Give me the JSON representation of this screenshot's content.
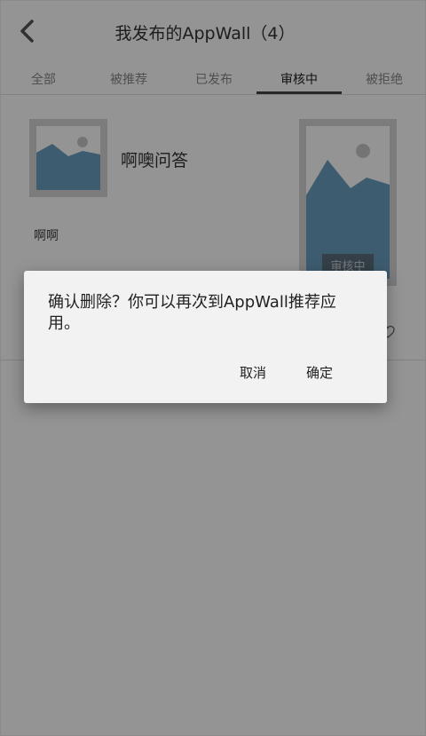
{
  "header": {
    "title": "我发布的AppWall（4）",
    "back_icon": "chevron-left-icon"
  },
  "tabs": [
    {
      "label": "全部",
      "active": false
    },
    {
      "label": "被推荐",
      "active": false
    },
    {
      "label": "已发布",
      "active": false
    },
    {
      "label": "审核中",
      "active": true
    },
    {
      "label": "被拒绝",
      "active": false
    }
  ],
  "card": {
    "app_name": "啊噢问答",
    "description": "啊啊",
    "status_badge": "审核中",
    "thumbnail_icon": "image-placeholder-icon",
    "poster_icon": "image-placeholder-icon",
    "like_icon": "heart-icon"
  },
  "dialog": {
    "message": "确认删除？你可以再次到AppWall推荐应用。",
    "cancel_label": "取消",
    "confirm_label": "确定"
  },
  "colors": {
    "overlay": "#000000",
    "dialog_bg": "#f2f2f2",
    "placeholder_blue": "#6a9fc0",
    "placeholder_bg": "#d6d6d6"
  }
}
